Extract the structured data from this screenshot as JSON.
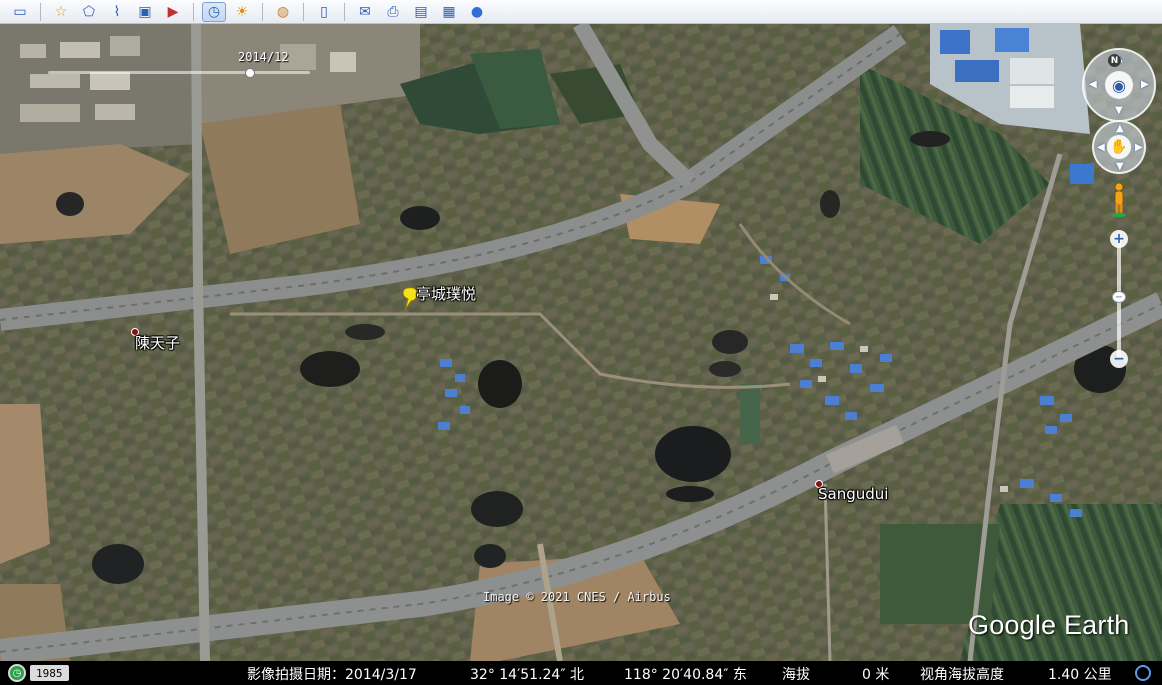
{
  "toolbar": {
    "buttons": [
      {
        "icon": "add-placemark-icon",
        "glyph": "☆"
      },
      {
        "icon": "add-polygon-icon",
        "glyph": "⬠"
      },
      {
        "icon": "add-path-icon",
        "glyph": "⌇"
      },
      {
        "icon": "add-image-overlay-icon",
        "glyph": "▣"
      },
      {
        "icon": "record-tour-icon",
        "glyph": "▶"
      },
      {
        "icon": "historical-imagery-icon",
        "glyph": "◷"
      },
      {
        "icon": "sunlight-icon",
        "glyph": "☀"
      },
      {
        "icon": "switch-planet-icon",
        "glyph": "◍"
      },
      {
        "icon": "ruler-icon",
        "glyph": "▯"
      },
      {
        "icon": "email-icon",
        "glyph": "✉"
      },
      {
        "icon": "print-icon",
        "glyph": "⎙"
      },
      {
        "icon": "save-image-icon",
        "glyph": "▤"
      },
      {
        "icon": "view-in-maps-icon",
        "glyph": "▦"
      },
      {
        "icon": "earth-gallery-icon",
        "glyph": "●"
      }
    ]
  },
  "map": {
    "slider_date": "2014/12",
    "places": {
      "placemark": "亭城璞悦",
      "chentianzi": "陳天子",
      "sangudui": "Sangudui"
    },
    "attribution": "Image © 2021 CNES / Airbus",
    "brand": "Google Earth",
    "nav": {
      "north": "N",
      "zoom_in": "+",
      "zoom_out": "−",
      "zoom_thumb": "−"
    },
    "time_slider_position": 0.78
  },
  "status": {
    "historical_year": "1985",
    "imagery_date": "影像拍摄日期：2014/3/17",
    "latitude": "32° 14′51.24″ 北",
    "longitude": "118° 20′40.84″ 东",
    "elevation_label": "海拔",
    "elevation_value": "0 米",
    "eye_alt_label": "视角海拔高度",
    "eye_alt_value": "1.40 公里"
  },
  "colors": {
    "status_bar": "#000000",
    "label_text": "#ffffff",
    "poi_marker": "#8c1010",
    "pushpin": "#f5e21b"
  }
}
